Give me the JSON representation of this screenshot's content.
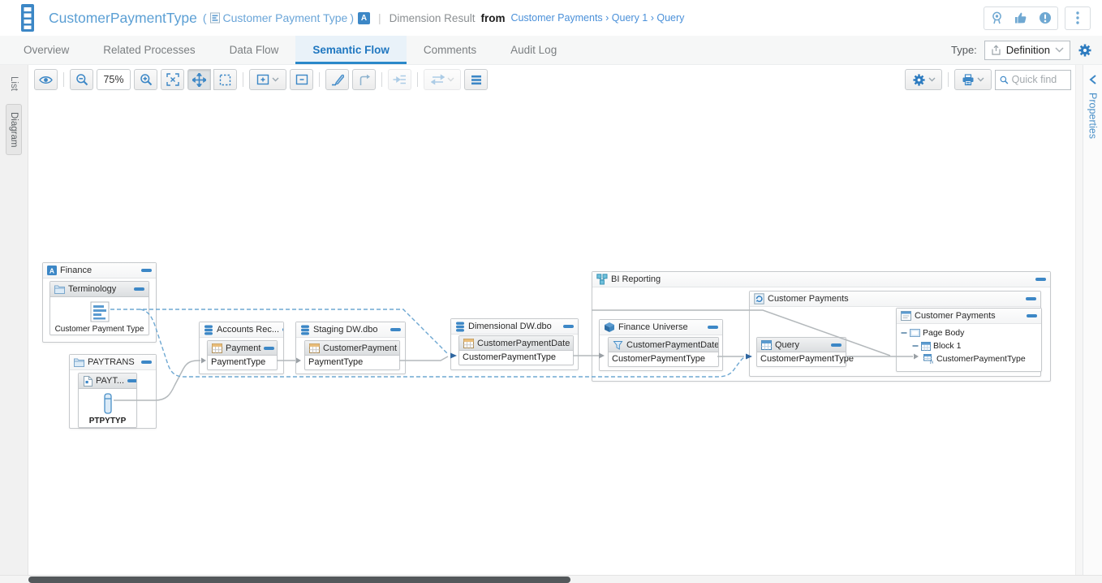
{
  "header": {
    "title": "CustomerPaymentType",
    "alias_prefix": "(",
    "alias": "Customer Payment Type",
    "alias_suffix": ")",
    "badge": "A",
    "separator": "|",
    "result_type": "Dimension Result",
    "from_label": "from",
    "breadcrumb": "Customer Payments › Query 1 › Query"
  },
  "tabs": {
    "items": [
      {
        "label": "Overview"
      },
      {
        "label": "Related Processes"
      },
      {
        "label": "Data Flow"
      },
      {
        "label": "Semantic Flow"
      },
      {
        "label": "Comments"
      },
      {
        "label": "Audit Log"
      }
    ],
    "active": "Semantic Flow",
    "type_label": "Type:",
    "type_value": "Definition"
  },
  "side": {
    "list_tab": "List",
    "diagram_tab": "Diagram",
    "properties_tab": "Properties"
  },
  "toolbar": {
    "zoom_level": "75%",
    "quick_find_placeholder": "Quick find"
  },
  "diagram": {
    "finance": {
      "title": "Finance",
      "terminology": {
        "title": "Terminology",
        "term": "Customer Payment Type"
      }
    },
    "paytrans": {
      "title": "PAYTRANS",
      "file": {
        "title": "PAYT...",
        "column": "PTPYTYP"
      }
    },
    "accounts": {
      "title": "Accounts Rec...",
      "table": {
        "title": "Payment",
        "column": "PaymentType"
      }
    },
    "staging": {
      "title": "Staging DW.dbo",
      "table": {
        "title": "CustomerPayment",
        "column": "PaymentType"
      }
    },
    "dimensional": {
      "title": "Dimensional DW.dbo",
      "table": {
        "title": "CustomerPaymentDate",
        "column": "CustomerPaymentType"
      }
    },
    "bi_reporting": {
      "title": "BI Reporting",
      "universe": {
        "title": "Finance Universe",
        "dimension_group": {
          "title": "CustomerPaymentDate",
          "item": "CustomerPaymentType"
        }
      },
      "document": {
        "title": "Customer Payments",
        "query": {
          "title": "Query",
          "item": "CustomerPaymentType"
        },
        "report": {
          "title": "Customer Payments",
          "tree": [
            "Page Body",
            "Block 1",
            "CustomerPaymentType"
          ]
        }
      }
    }
  },
  "colors": {
    "accent_blue": "#3c87c6",
    "title_blue": "#5b9fd4",
    "link_blue": "#4a90d9",
    "active_tab_blue": "#1f77c0",
    "dashed_link": "#6fa8d2",
    "solid_link": "#b4b9bc",
    "table_icon_header_tan": "#e9bd7a",
    "scrollbar_thumb": "#54585b"
  }
}
